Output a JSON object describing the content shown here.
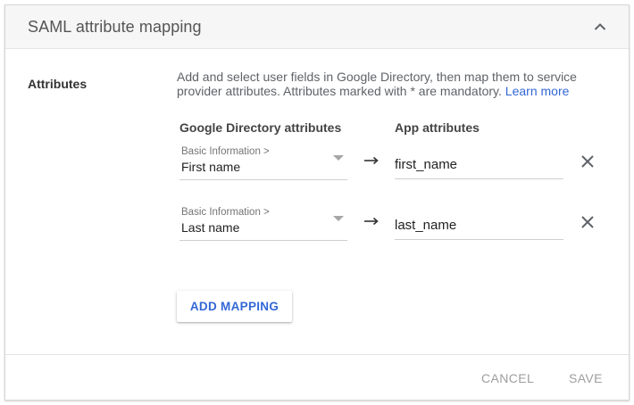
{
  "card": {
    "title": "SAML attribute mapping",
    "collapse_icon": "chevron-up-icon"
  },
  "attributes": {
    "label": "Attributes",
    "description": "Add and select user fields in Google Directory, then map them to service provider attributes. Attributes marked with * are mandatory.",
    "learn_more": "Learn more"
  },
  "columns": {
    "google_directory": "Google Directory attributes",
    "app": "App attributes"
  },
  "mappings": [
    {
      "category": "Basic Information >",
      "field": "First name",
      "app_attribute": "first_name"
    },
    {
      "category": "Basic Information >",
      "field": "Last name",
      "app_attribute": "last_name"
    }
  ],
  "add_mapping_label": "ADD MAPPING",
  "footer": {
    "cancel_label": "CANCEL",
    "save_label": "SAVE"
  },
  "colors": {
    "accent": "#3367d6",
    "header_bg": "#f6f6f6",
    "disabled_text": "#9e9e9e"
  }
}
